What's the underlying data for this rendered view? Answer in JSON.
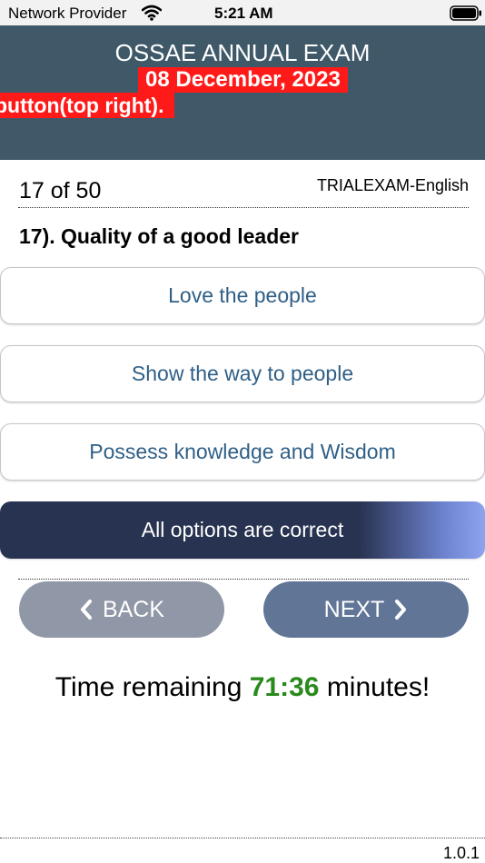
{
  "status_bar": {
    "carrier": "Network Provider",
    "time": "5:21 AM"
  },
  "header": {
    "title": "OSSAE ANNUAL EXAM",
    "date": "08 December, 2023",
    "marquee": "button(top right)."
  },
  "exam": {
    "question_counter": "17 of 50",
    "exam_name": "TRIALEXAM-English",
    "question": "17). Quality of a good leader",
    "options": [
      {
        "label": "Love the people",
        "selected": false
      },
      {
        "label": "Show the way to people",
        "selected": false
      },
      {
        "label": "Possess knowledge and Wisdom",
        "selected": false
      },
      {
        "label": "All options are correct",
        "selected": true
      }
    ]
  },
  "nav": {
    "back_label": "BACK",
    "next_label": "NEXT"
  },
  "timer": {
    "prefix": "Time remaining ",
    "value": "71:36",
    "suffix": " minutes!"
  },
  "footer": {
    "version": "1.0.1"
  },
  "colors": {
    "header_bg": "#3f5968",
    "highlight_red": "#ff1a1a",
    "timer_green": "#2b8a1e",
    "selected_option": "#273350"
  }
}
